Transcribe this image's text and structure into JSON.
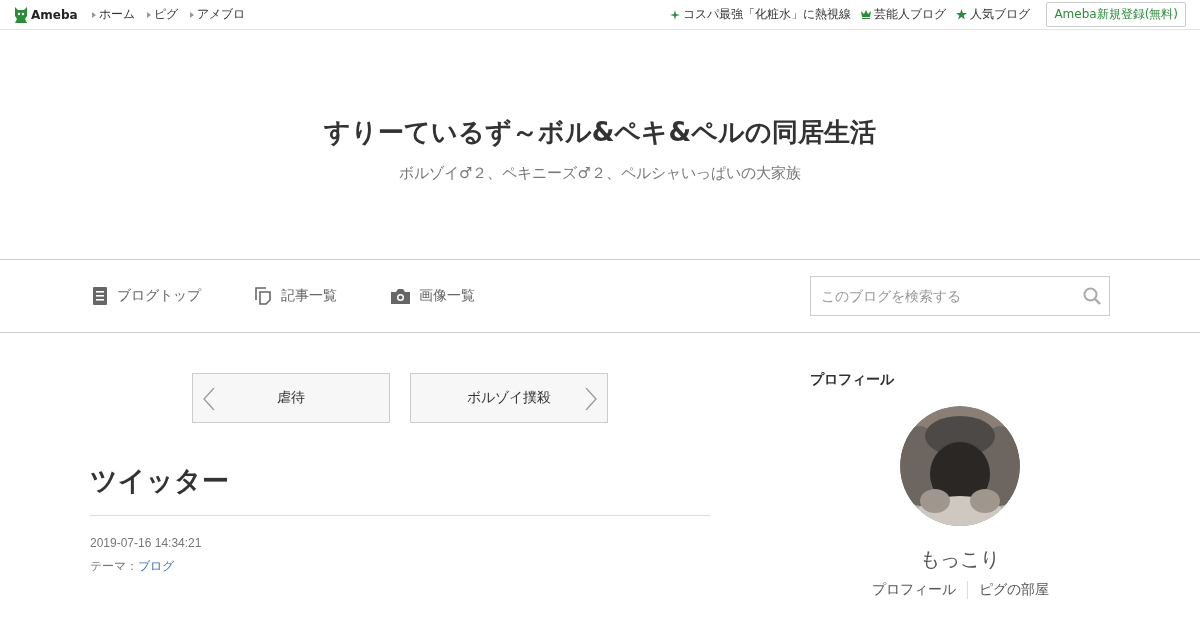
{
  "header": {
    "logo": "Ameba",
    "links": [
      "ホーム",
      "ピグ",
      "アメブロ"
    ],
    "promos": [
      {
        "kind": "sparkle",
        "label": "コスパ最強「化粧水」に熱視線"
      },
      {
        "kind": "crown",
        "label": "芸能人ブログ"
      },
      {
        "kind": "star",
        "label": "人気ブログ"
      }
    ],
    "signup": "Ameba新規登録(無料)"
  },
  "blog": {
    "title": "すりーているず～ボル&ペキ&ペルの同居生活",
    "subtitle": "ボルゾイ♂２、ペキニーズ♂２、ペルシャいっぱいの大家族"
  },
  "nav": [
    {
      "kind": "list",
      "label": "ブログトップ"
    },
    {
      "kind": "pages",
      "label": "記事一覧"
    },
    {
      "kind": "camera",
      "label": "画像一覧"
    }
  ],
  "search": {
    "placeholder": "このブログを検索する"
  },
  "pager": {
    "prev": "虐待",
    "next": "ボルゾイ撲殺"
  },
  "article": {
    "title": "ツイッター",
    "date": "2019-07-16 14:34:21",
    "theme_label": "テーマ：",
    "theme": "ブログ"
  },
  "profile": {
    "heading": "プロフィール",
    "avatar": {
      "kind": "picture"
    },
    "name": "もっこり",
    "links": [
      "プロフィール",
      "ピグの部屋"
    ]
  }
}
